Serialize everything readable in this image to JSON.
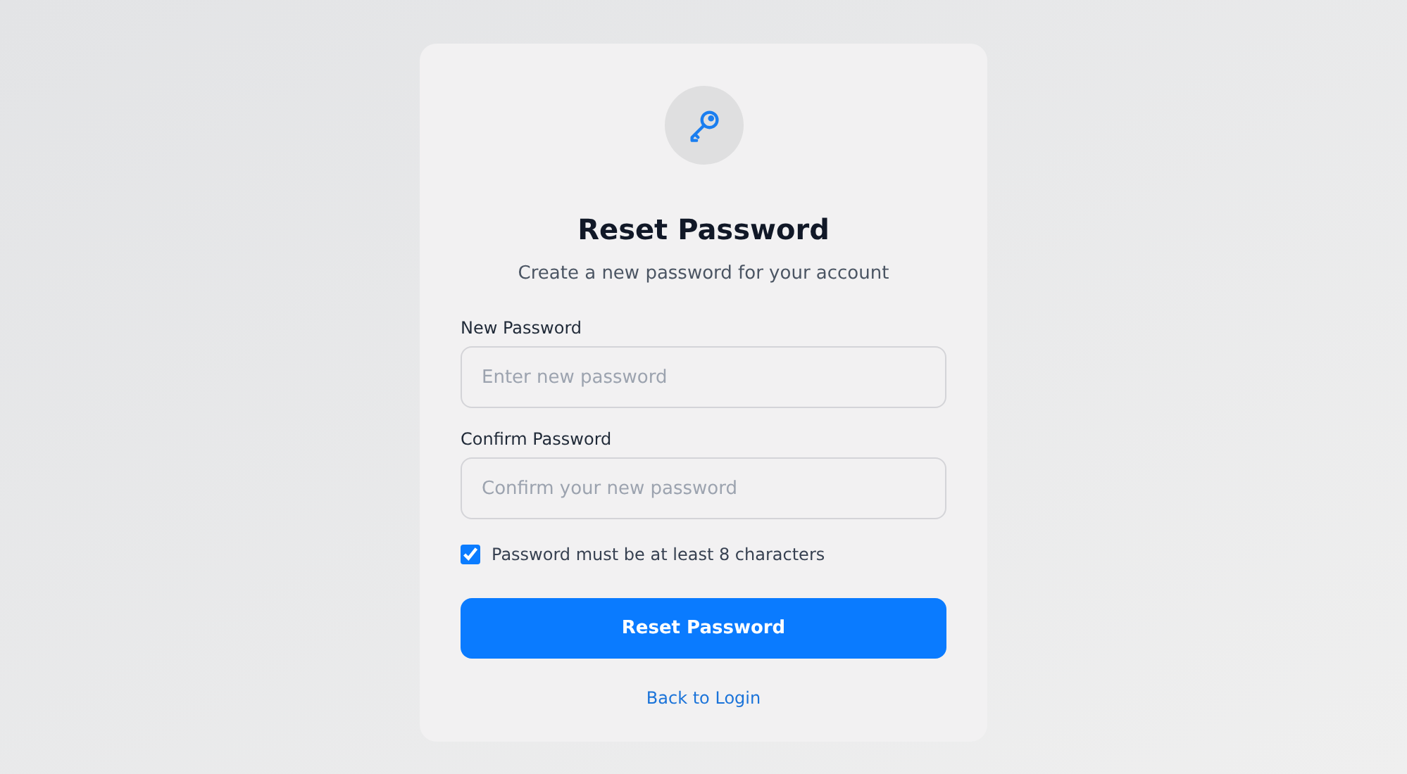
{
  "title": "Reset Password",
  "subtitle": "Create a new password for your account",
  "fields": [
    {
      "label": "New Password",
      "placeholder": "Enter new password"
    },
    {
      "label": "Confirm Password",
      "placeholder": "Confirm your new password"
    }
  ],
  "requirement": {
    "label": "Password must be at least 8 characters",
    "checked": true
  },
  "submit": "Reset Password",
  "back_link": "Back to Login"
}
